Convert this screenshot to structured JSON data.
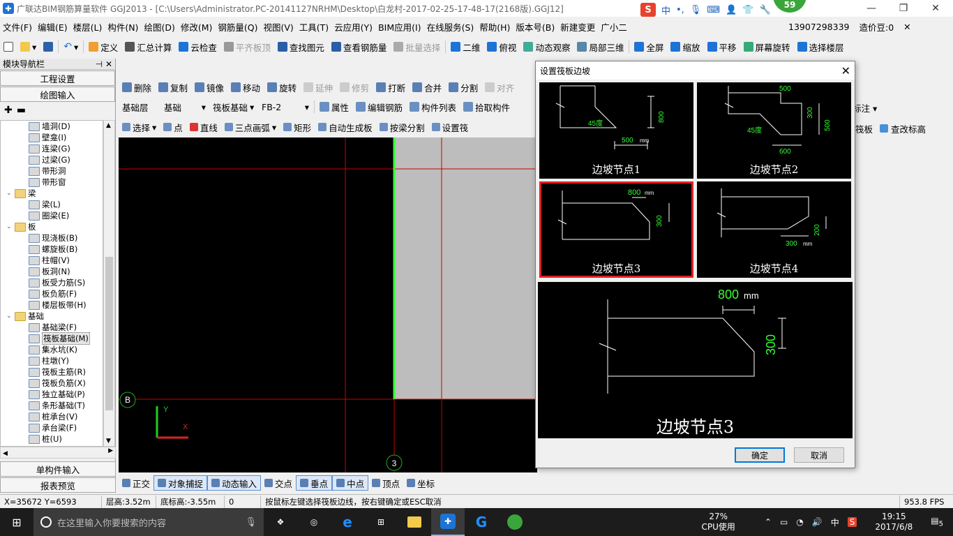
{
  "window": {
    "title": "广联达BIM钢筋算量软件 GGJ2013 - [C:\\Users\\Administrator.PC-20141127NRHM\\Desktop\\白龙村-2017-02-25-17-48-17(2168版).GGJ12]",
    "badge": "59"
  },
  "ime": {
    "lang": "中"
  },
  "menu": [
    "文件(F)",
    "编辑(E)",
    "楼层(L)",
    "构件(N)",
    "绘图(D)",
    "修改(M)",
    "钢筋量(Q)",
    "视图(V)",
    "工具(T)",
    "云应用(Y)",
    "BIM应用(I)",
    "在线服务(S)",
    "帮助(H)",
    "版本号(B)",
    "新建变更",
    "广小二"
  ],
  "account": {
    "phone": "13907298339",
    "price": "造价豆:0"
  },
  "toolbar1": [
    "定义",
    "汇总计算",
    "云检查",
    "平齐板顶",
    "查找图元",
    "查看钢筋量",
    "批量选择",
    "二维",
    "俯视",
    "动态观察",
    "局部三维",
    "全屏",
    "缩放",
    "平移",
    "屏幕旋转",
    "选择楼层"
  ],
  "toolbar2": [
    "删除",
    "复制",
    "镜像",
    "移动",
    "旋转",
    "延伸",
    "修剪",
    "打断",
    "合并",
    "分割",
    "对齐"
  ],
  "toolbar3": {
    "floor": "基础层",
    "type": "基础",
    "category": "筏板基础",
    "element": "FB-2",
    "buttons": [
      "属性",
      "编辑钢筋",
      "构件列表",
      "拾取构件"
    ],
    "extra": "标注"
  },
  "toolbar4": [
    "选择",
    "点",
    "直线",
    "三点画弧",
    "矩形",
    "自动生成板",
    "按梁分割",
    "设置筏",
    "筏板",
    "查改标高"
  ],
  "panel": {
    "title": "模块导航栏",
    "btn_project": "工程设置",
    "btn_draw": "绘图输入",
    "btn_single": "单构件输入",
    "btn_report": "报表预览",
    "tree": [
      {
        "label": "墙洞(D)",
        "level": 2
      },
      {
        "label": "壁龛(I)",
        "level": 2
      },
      {
        "label": "连梁(G)",
        "level": 2
      },
      {
        "label": "过梁(G)",
        "level": 2
      },
      {
        "label": "带形洞",
        "level": 2
      },
      {
        "label": "带形窗",
        "level": 2
      },
      {
        "label": "梁",
        "level": 1,
        "group": true
      },
      {
        "label": "梁(L)",
        "level": 2
      },
      {
        "label": "圈梁(E)",
        "level": 2
      },
      {
        "label": "板",
        "level": 1,
        "group": true
      },
      {
        "label": "现浇板(B)",
        "level": 2
      },
      {
        "label": "螺旋板(B)",
        "level": 2
      },
      {
        "label": "柱帽(V)",
        "level": 2
      },
      {
        "label": "板洞(N)",
        "level": 2
      },
      {
        "label": "板受力筋(S)",
        "level": 2
      },
      {
        "label": "板负筋(F)",
        "level": 2
      },
      {
        "label": "楼层板带(H)",
        "level": 2
      },
      {
        "label": "基础",
        "level": 1,
        "group": true
      },
      {
        "label": "基础梁(F)",
        "level": 2
      },
      {
        "label": "筏板基础(M)",
        "level": 2,
        "selected": true
      },
      {
        "label": "集水坑(K)",
        "level": 2
      },
      {
        "label": "柱墩(Y)",
        "level": 2
      },
      {
        "label": "筏板主筋(R)",
        "level": 2
      },
      {
        "label": "筏板负筋(X)",
        "level": 2
      },
      {
        "label": "独立基础(P)",
        "level": 2
      },
      {
        "label": "条形基础(T)",
        "level": 2
      },
      {
        "label": "桩承台(V)",
        "level": 2
      },
      {
        "label": "承台梁(F)",
        "level": 2
      },
      {
        "label": "桩(U)",
        "level": 2
      }
    ]
  },
  "canvas": {
    "axis_b": "B",
    "axis_3": "3",
    "axis_y": "Y",
    "axis_x": "X"
  },
  "snapbar": [
    "正交",
    "对象捕捉",
    "动态输入",
    "交点",
    "垂点",
    "中点",
    "顶点",
    "坐标"
  ],
  "status": {
    "coords": "X=35672 Y=6593",
    "floor_height": "层高:3.52m",
    "bottom_height": "底标高:-3.55m",
    "zero": "0",
    "hint": "按鼠标左键选择筏板边线，按右键确定或ESC取消",
    "fps": "953.8 FPS"
  },
  "dialog": {
    "title": "设置筏板边坡",
    "nodes": [
      {
        "caption": "边坡节点1",
        "dim_a": "45度",
        "dim_b": "500",
        "dim_c": "800",
        "unit": "mm"
      },
      {
        "caption": "边坡节点2",
        "dim_a": "500",
        "dim_b": "300",
        "dim_c": "500",
        "dim_d": "45度",
        "dim_e": "600",
        "unit": "mm"
      },
      {
        "caption": "边坡节点3",
        "dim_a": "800",
        "dim_b": "300",
        "unit": "mm"
      },
      {
        "caption": "边坡节点4",
        "dim_a": "300",
        "dim_b": "200",
        "unit": "mm"
      }
    ],
    "preview": {
      "caption": "边坡节点3",
      "dim_h": "800",
      "dim_v": "300",
      "unit": "mm"
    },
    "ok": "确定",
    "cancel": "取消"
  },
  "taskbar": {
    "search_placeholder": "在这里输入你要搜索的内容",
    "cpu_percent": "27%",
    "cpu_label": "CPU使用",
    "ime": "中",
    "time": "19:15",
    "date": "2017/6/8",
    "notif": "5"
  }
}
